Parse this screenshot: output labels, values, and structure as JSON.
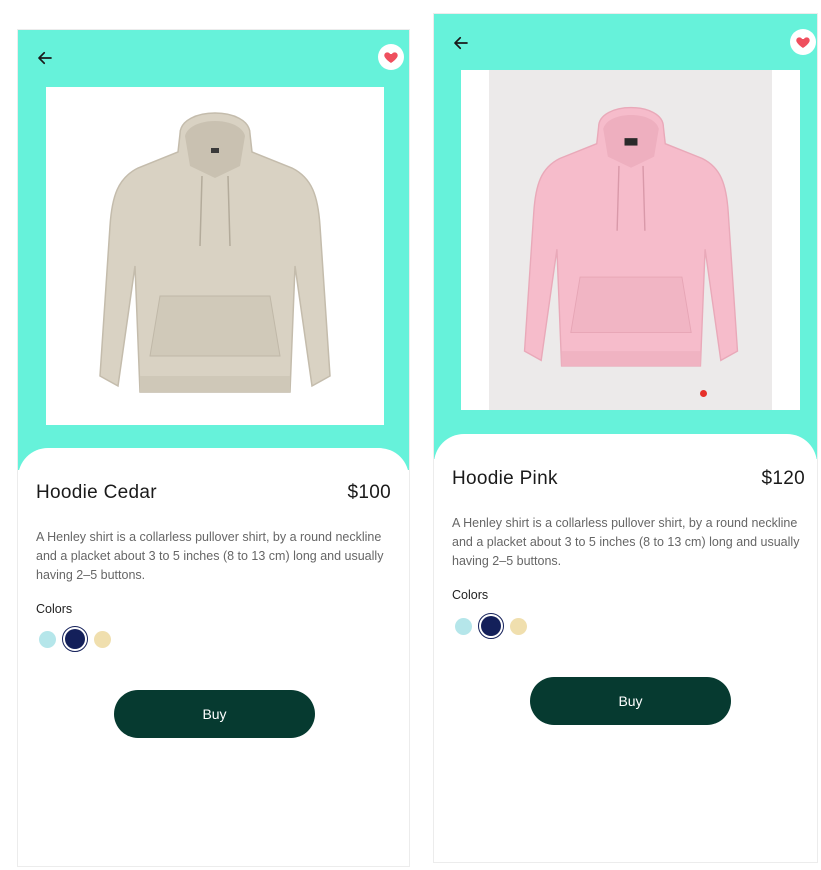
{
  "colors": {
    "accent": "#66f2da",
    "buy_button": "#063a30",
    "favorite": "#ef4f5e"
  },
  "icons": {
    "back": "arrow-left-icon",
    "favorite": "heart-icon"
  },
  "screens": [
    {
      "title": "Hoodie Cedar",
      "price": "$100",
      "description": "A Henley shirt is a collarless pullover shirt, by a round neckline and a placket about 3 to 5 inches (8 to 13 cm) long and usually having 2–5 buttons.",
      "colors_label": "Colors",
      "swatches": [
        "#b5e6ea",
        "#14205a",
        "#f0dfae"
      ],
      "selected_swatch": 1,
      "buy_label": "Buy",
      "product_color": "#d9d2c3"
    },
    {
      "title": "Hoodie Pink",
      "price": "$120",
      "description": "A Henley shirt is a collarless pullover shirt, by a round neckline and a placket about 3 to 5 inches (8 to 13 cm) long and usually having 2–5 buttons.",
      "colors_label": "Colors",
      "swatches": [
        "#b5e6ea",
        "#14205a",
        "#f0dfae"
      ],
      "selected_swatch": 1,
      "buy_label": "Buy",
      "product_color": "#f6bccb"
    }
  ]
}
